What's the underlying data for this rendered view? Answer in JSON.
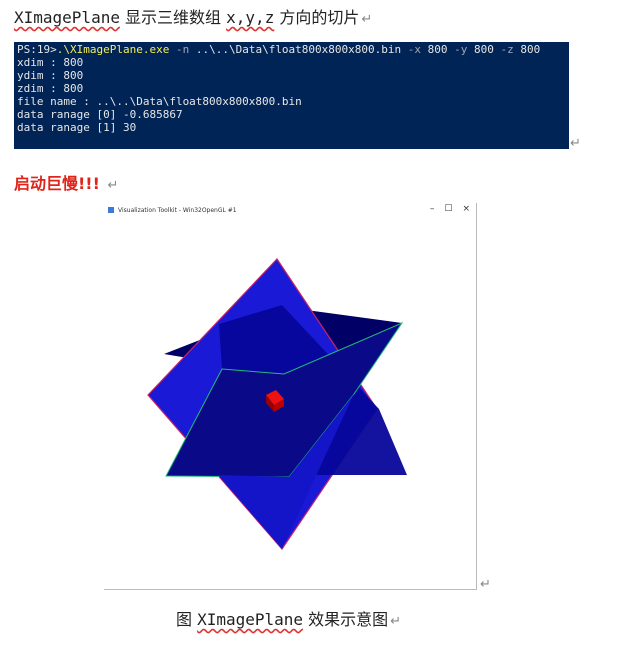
{
  "heading": {
    "prefix": "XImagePlane",
    "mid": " 显示三维数组 ",
    "vars": "x,y,z",
    "suffix": " 方向的切片",
    "return_mark": "↵"
  },
  "terminal": {
    "prompt": "PS:19>",
    "exe": ".\\XImagePlane.exe",
    "flag_n": " -n ",
    "path": "..\\..\\Data\\float800x800x800.bin",
    "flag_x": " -x ",
    "val_x": "800",
    "flag_y": " -y ",
    "val_y": "800",
    "flag_z": " -z ",
    "val_z": "800",
    "lines": [
      "xdim : 800",
      "ydim : 800",
      "zdim : 800",
      "file name : ..\\..\\Data\\float800x800x800.bin",
      "data ranage [0] -0.685867",
      "data ranage [1] 30"
    ]
  },
  "slow_note": "启动巨慢!!!",
  "vtk_window": {
    "title": "Visualization Toolkit - Win32OpenGL #1",
    "minimize": "–",
    "maximize": "☐",
    "close": "×"
  },
  "colors": {
    "terminal_bg": "#012456",
    "plane_blue": "#1a1ad6",
    "cube_red": "#cc0000",
    "warning_red": "#e0241a"
  },
  "caption": {
    "prefix": "图 ",
    "name": "XImagePlane",
    "suffix": " 效果示意图"
  }
}
